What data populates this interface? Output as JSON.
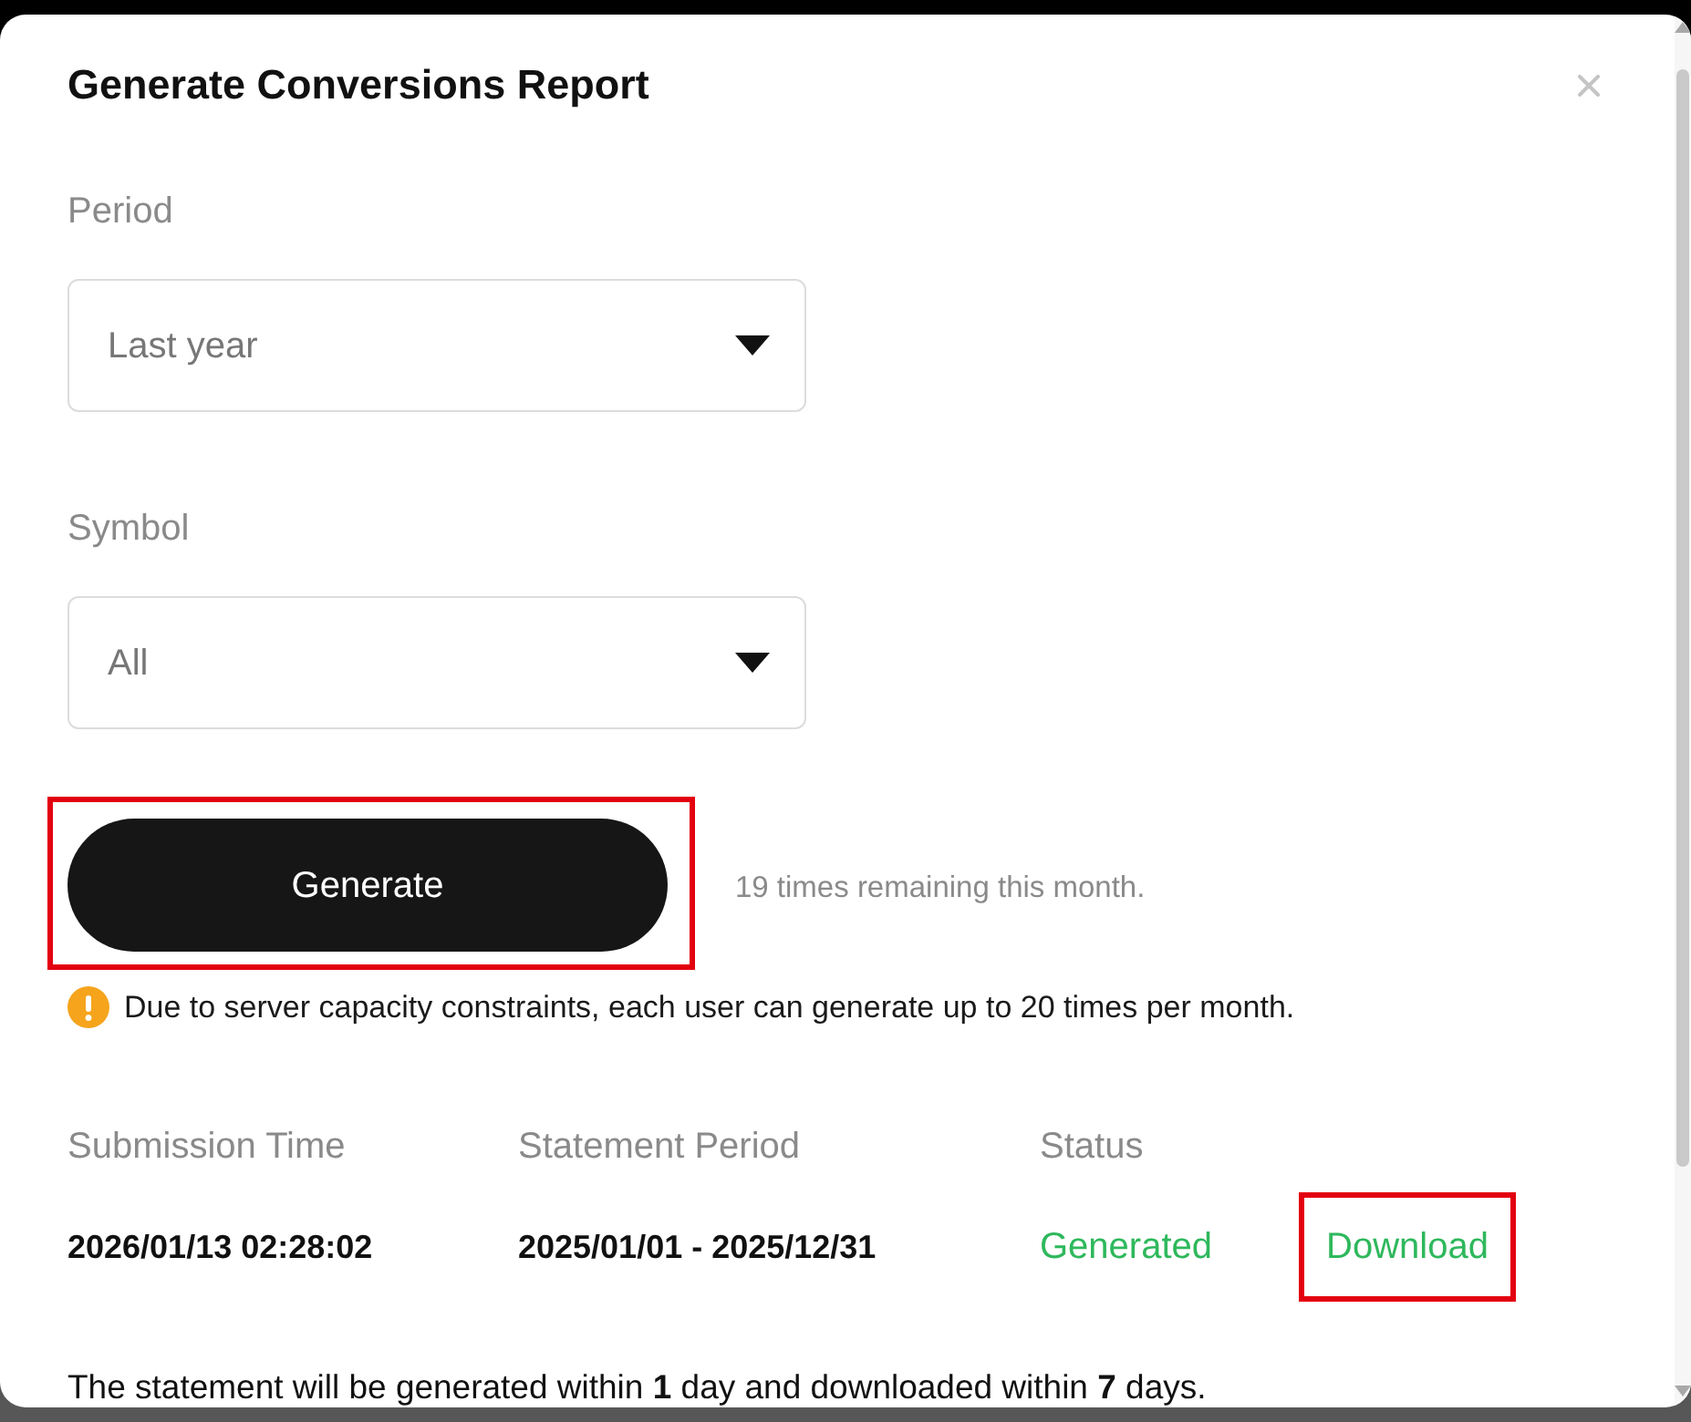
{
  "dialog": {
    "title": "Generate Conversions Report"
  },
  "fields": [
    {
      "label": "Period",
      "value": "Last year"
    },
    {
      "label": "Symbol",
      "value": "All"
    }
  ],
  "generate": {
    "label": "Generate",
    "highlighted": true,
    "remaining": "19 times remaining this month."
  },
  "notice": "Due to server capacity constraints, each user can generate up to 20 times per month.",
  "table": {
    "columns": [
      "Submission Time",
      "Statement Period",
      "Status"
    ],
    "rows": [
      {
        "cells": [
          "2026/01/13 02:28:02",
          "2025/01/01 - 2025/12/31"
        ],
        "status": "Generated",
        "action": {
          "label": "Download",
          "highlighted": true
        }
      }
    ]
  },
  "footnote": "The statement will be generated within **1** day and downloaded within **7** days."
}
